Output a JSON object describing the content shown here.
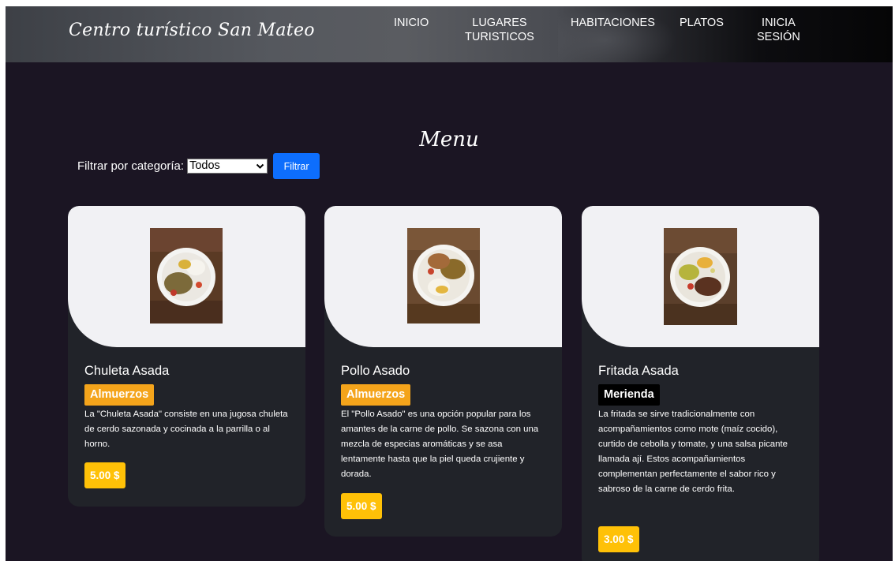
{
  "header": {
    "brand": "Centro turístico San Mateo",
    "nav": [
      {
        "label": "INICIO"
      },
      {
        "label_line1": "LUGARES",
        "label_line2": "TURISTICOS"
      },
      {
        "label": "HABITACIONES"
      },
      {
        "label": "PLATOS"
      },
      {
        "label_line1": "INICIA",
        "label_line2": "SESIÓN"
      }
    ]
  },
  "main": {
    "title": "Menu",
    "filter": {
      "label": "Filtrar por categoría:",
      "selected": "Todos",
      "button": "Filtrar"
    },
    "cards": [
      {
        "title": "Chuleta Asada",
        "category": "Almuerzos",
        "description": "La \"Chuleta Asada\" consiste en una jugosa chuleta de cerdo sazonada y cocinada a la parrilla o al horno.",
        "price": "5.00 $"
      },
      {
        "title": "Pollo Asado",
        "category": "Almuerzos",
        "description": "El \"Pollo Asado\" es una opción popular para los amantes de la carne de pollo. Se sazona con una mezcla de especias aromáticas y se asa lentamente hasta que la piel queda crujiente y dorada.",
        "price": "5.00 $"
      },
      {
        "title": "Fritada Asada",
        "category": "Merienda",
        "description": "La fritada se sirve tradicionalmente con acompañamientos como mote (maíz cocido), curtido de cebolla y tomate, y una salsa picante llamada ají. Estos acompañamientos complementan perfectamente el sabor rico y sabroso de la carne de cerdo frita.",
        "price": "3.00 $"
      }
    ]
  },
  "colors": {
    "page_background": "#1b1523",
    "card_background": "#212329",
    "badge_almuerzos": "#f4a41b",
    "badge_merienda": "#000000",
    "price_badge": "#ffc107",
    "filter_button": "#0d6efd"
  }
}
